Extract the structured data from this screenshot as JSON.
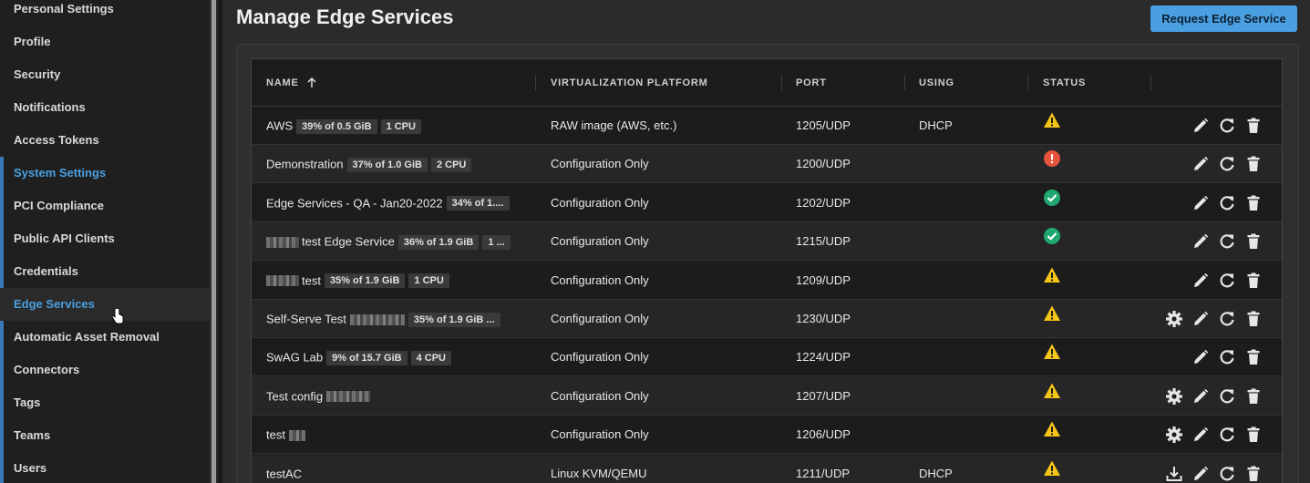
{
  "sidebar": {
    "items": [
      {
        "label": "Personal Settings",
        "state": "header"
      },
      {
        "label": "Profile",
        "state": "normal"
      },
      {
        "label": "Security",
        "state": "normal"
      },
      {
        "label": "Notifications",
        "state": "normal"
      },
      {
        "label": "Access Tokens",
        "state": "normal"
      },
      {
        "label": "System Settings",
        "state": "header-active"
      },
      {
        "label": "PCI Compliance",
        "state": "normal"
      },
      {
        "label": "Public API Clients",
        "state": "normal"
      },
      {
        "label": "Credentials",
        "state": "normal"
      },
      {
        "label": "Edge Services",
        "state": "active"
      },
      {
        "label": "Automatic Asset Removal",
        "state": "normal"
      },
      {
        "label": "Connectors",
        "state": "normal"
      },
      {
        "label": "Tags",
        "state": "normal"
      },
      {
        "label": "Teams",
        "state": "normal"
      },
      {
        "label": "Users",
        "state": "normal"
      }
    ]
  },
  "main": {
    "title": "Manage Edge Services",
    "request_button": "Request Edge Service"
  },
  "table": {
    "columns": {
      "name": "NAME",
      "platform": "VIRTUALIZATION PLATFORM",
      "port": "PORT",
      "using": "USING",
      "status": "STATUS"
    },
    "sort": {
      "column": "name",
      "direction": "ascending",
      "icon": "arrow-up-icon"
    },
    "rows": [
      {
        "name": "AWS",
        "badges": [
          "39% of 0.5 GiB",
          "1 CPU"
        ],
        "platform": "RAW image (AWS, etc.)",
        "port": "1205/UDP",
        "using": "DHCP",
        "status": "warning",
        "actions": [
          "edit",
          "restart",
          "delete"
        ]
      },
      {
        "name": "Demonstration",
        "badges": [
          "37% of 1.0 GiB",
          "2 CPU"
        ],
        "platform": "Configuration Only",
        "port": "1200/UDP",
        "using": "",
        "status": "error",
        "actions": [
          "edit",
          "restart",
          "delete"
        ]
      },
      {
        "name": "Edge Services - QA - Jan20-2022",
        "badges": [
          "34% of 1...."
        ],
        "platform": "Configuration Only",
        "port": "1202/UDP",
        "using": "",
        "status": "ok",
        "actions": [
          "edit",
          "restart",
          "delete"
        ]
      },
      {
        "name": "test Edge Service",
        "badges": [
          "36% of 1.9 GiB",
          "1 ..."
        ],
        "platform": "Configuration Only",
        "port": "1215/UDP",
        "using": "",
        "status": "ok",
        "actions": [
          "edit",
          "restart",
          "delete"
        ]
      },
      {
        "name": "test",
        "badges": [
          "35% of 1.9 GiB",
          "1 CPU"
        ],
        "platform": "Configuration Only",
        "port": "1209/UDP",
        "using": "",
        "status": "warning",
        "actions": [
          "edit",
          "restart",
          "delete"
        ]
      },
      {
        "name": "Self-Serve Test",
        "badges": [
          "35% of 1.9 GiB ..."
        ],
        "platform": "Configuration Only",
        "port": "1230/UDP",
        "using": "",
        "status": "warning",
        "actions": [
          "settings",
          "edit",
          "restart",
          "delete"
        ]
      },
      {
        "name": "SwAG Lab",
        "badges": [
          "9% of 15.7 GiB",
          "4 CPU"
        ],
        "platform": "Configuration Only",
        "port": "1224/UDP",
        "using": "",
        "status": "warning",
        "actions": [
          "edit",
          "restart",
          "delete"
        ]
      },
      {
        "name": "Test config",
        "badges": [],
        "platform": "Configuration Only",
        "port": "1207/UDP",
        "using": "",
        "status": "warning",
        "actions": [
          "settings",
          "edit",
          "restart",
          "delete"
        ]
      },
      {
        "name": "test",
        "badges": [],
        "platform": "Configuration Only",
        "port": "1206/UDP",
        "using": "",
        "status": "warning",
        "actions": [
          "settings",
          "edit",
          "restart",
          "delete"
        ]
      },
      {
        "name": "testAC",
        "badges": [],
        "platform": "Linux KVM/QEMU",
        "port": "1211/UDP",
        "using": "DHCP",
        "status": "warning",
        "actions": [
          "download",
          "edit",
          "restart",
          "delete"
        ]
      }
    ]
  },
  "colors": {
    "accent": "#4a9fe0",
    "warning": "#f5c518",
    "error": "#e5533d",
    "ok": "#1fa971"
  }
}
